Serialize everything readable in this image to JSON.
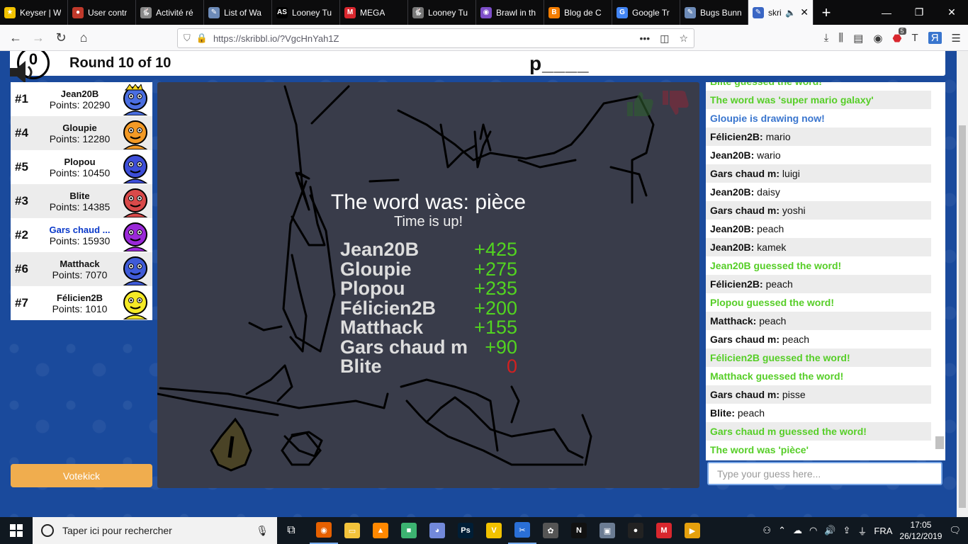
{
  "browser": {
    "tabs": [
      {
        "title": "Keyser | W",
        "color": "#f2c200",
        "glyph": "★"
      },
      {
        "title": "User contr",
        "color": "#c0392b",
        "glyph": "●"
      },
      {
        "title": "Activité ré",
        "color": "#888888",
        "glyph": "🐇"
      },
      {
        "title": "List of Wa",
        "color": "#6d8bb8",
        "glyph": "✎"
      },
      {
        "title": "Looney Tu",
        "color": "#000000",
        "glyph": "AS"
      },
      {
        "title": "MEGA",
        "color": "#d9272e",
        "glyph": "M"
      },
      {
        "title": "Looney Tu",
        "color": "#777777",
        "glyph": "🐇"
      },
      {
        "title": "Brawl in th",
        "color": "#7d4ec9",
        "glyph": "◉"
      },
      {
        "title": "Blog de C",
        "color": "#f57d00",
        "glyph": "B"
      },
      {
        "title": "Google Tr",
        "color": "#4285f4",
        "glyph": "G"
      },
      {
        "title": "Bugs Bunn",
        "color": "#6d8bb8",
        "glyph": "✎"
      }
    ],
    "active_tab": {
      "title": "skri",
      "color": "#3a66c4",
      "glyph": "✎"
    },
    "url": "https://skribbl.io/?VgcHnYah1Z",
    "badge_count": "5"
  },
  "game": {
    "timer": "0",
    "round_label": "Round 10 of 10",
    "word_hint": "p____",
    "votekick_label": "Votekick"
  },
  "players": [
    {
      "rank": "#1",
      "name": "Jean20B",
      "points": "Points: 20290",
      "color": "#4a6ee0",
      "crown": true,
      "me": false
    },
    {
      "rank": "#4",
      "name": "Gloupie",
      "points": "Points: 12280",
      "color": "#f39a26",
      "crown": false,
      "me": false
    },
    {
      "rank": "#5",
      "name": "Plopou",
      "points": "Points: 10450",
      "color": "#3d4ed8",
      "crown": false,
      "me": false
    },
    {
      "rank": "#3",
      "name": "Blite",
      "points": "Points: 14385",
      "color": "#d94a4a",
      "crown": false,
      "me": false
    },
    {
      "rank": "#2",
      "name": "Gars chaud ...",
      "points": "Points: 15930",
      "color": "#9b29d9",
      "crown": false,
      "me": true
    },
    {
      "rank": "#6",
      "name": "Matthack",
      "points": "Points: 7070",
      "color": "#3f5bd8",
      "crown": false,
      "me": false
    },
    {
      "rank": "#7",
      "name": "Félicien2B",
      "points": "Points: 1010",
      "color": "#f5ea26",
      "crown": false,
      "me": false
    }
  ],
  "overlay": {
    "title": "The word was: pièce",
    "subtitle": "Time is up!",
    "results": [
      {
        "name": "Jean20B",
        "score": "+425"
      },
      {
        "name": "Gloupie",
        "score": "+275"
      },
      {
        "name": "Plopou",
        "score": "+235"
      },
      {
        "name": "Félicien2B",
        "score": "+200"
      },
      {
        "name": "Matthack",
        "score": "+155"
      },
      {
        "name": "Gars chaud m",
        "score": "+90"
      },
      {
        "name": "Blite",
        "score": "0"
      }
    ]
  },
  "chat": {
    "messages": [
      {
        "type": "green",
        "author": "",
        "text": "Blite guessed the word!"
      },
      {
        "type": "green",
        "author": "",
        "text": "The word was 'super mario galaxy'"
      },
      {
        "type": "blue",
        "author": "",
        "text": "Gloupie is drawing now!"
      },
      {
        "type": "msg",
        "author": "Félicien2B:",
        "text": " mario"
      },
      {
        "type": "msg",
        "author": "Jean20B:",
        "text": " wario"
      },
      {
        "type": "msg",
        "author": "Gars chaud m:",
        "text": " luigi"
      },
      {
        "type": "msg",
        "author": "Jean20B:",
        "text": " daisy"
      },
      {
        "type": "msg",
        "author": "Gars chaud m:",
        "text": " yoshi"
      },
      {
        "type": "msg",
        "author": "Jean20B:",
        "text": " peach"
      },
      {
        "type": "msg",
        "author": "Jean20B:",
        "text": " kamek"
      },
      {
        "type": "green",
        "author": "",
        "text": "Jean20B guessed the word!"
      },
      {
        "type": "msg",
        "author": "Félicien2B:",
        "text": " peach"
      },
      {
        "type": "green",
        "author": "",
        "text": "Plopou guessed the word!"
      },
      {
        "type": "msg",
        "author": "Matthack:",
        "text": " peach"
      },
      {
        "type": "msg",
        "author": "Gars chaud m:",
        "text": " peach"
      },
      {
        "type": "green",
        "author": "",
        "text": "Félicien2B guessed the word!"
      },
      {
        "type": "green",
        "author": "",
        "text": "Matthack guessed the word!"
      },
      {
        "type": "msg",
        "author": "Gars chaud m:",
        "text": " pisse"
      },
      {
        "type": "msg",
        "author": "Blite:",
        "text": " peach"
      },
      {
        "type": "green",
        "author": "",
        "text": "Gars chaud m guessed the word!"
      },
      {
        "type": "green",
        "author": "",
        "text": "The word was 'pièce'"
      }
    ],
    "input_placeholder": "Type your guess here..."
  },
  "taskbar": {
    "search_placeholder": "Taper ici pour rechercher",
    "language": "FRA",
    "time": "17:05",
    "date": "26/12/2019",
    "apps": [
      {
        "name": "firefox-icon",
        "color": "#e66000",
        "glyph": "◉",
        "open": true
      },
      {
        "name": "file-explorer-icon",
        "color": "#f3c33b",
        "glyph": "▭",
        "open": false
      },
      {
        "name": "vlc-icon",
        "color": "#ff8800",
        "glyph": "▲",
        "open": false
      },
      {
        "name": "paint-icon",
        "color": "#3cb371",
        "glyph": "■",
        "open": false
      },
      {
        "name": "discord-icon",
        "color": "#7289da",
        "glyph": "◕",
        "open": false
      },
      {
        "name": "photoshop-icon",
        "color": "#001e36",
        "glyph": "Ps",
        "open": false
      },
      {
        "name": "vectorize-icon",
        "color": "#f2c200",
        "glyph": "V",
        "open": false
      },
      {
        "name": "movie-maker-icon",
        "color": "#2a6fd6",
        "glyph": "✂",
        "open": true
      },
      {
        "name": "paint3d-icon",
        "color": "#555555",
        "glyph": "✿",
        "open": false
      },
      {
        "name": "netflix-icon",
        "color": "#111111",
        "glyph": "N",
        "open": false
      },
      {
        "name": "photos-icon",
        "color": "#6b7c93",
        "glyph": "▣",
        "open": false
      },
      {
        "name": "obs-icon",
        "color": "#222222",
        "glyph": "●",
        "open": false
      },
      {
        "name": "mega-icon",
        "color": "#d9272e",
        "glyph": "M",
        "open": false
      },
      {
        "name": "plex-icon",
        "color": "#e5a00d",
        "glyph": "▶",
        "open": false
      }
    ]
  }
}
